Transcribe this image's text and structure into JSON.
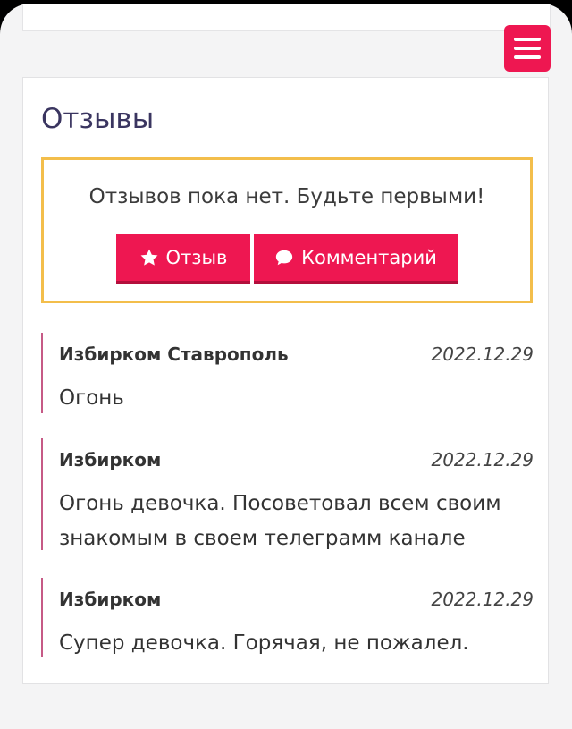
{
  "reviews": {
    "title": "Отзывы",
    "empty_message": "Отзывов пока нет. Будьте первыми!",
    "review_button_label": "Отзыв",
    "comment_button_label": "Комментарий"
  },
  "comments": [
    {
      "author": "Избирком Ставрополь",
      "date": "2022.12.29",
      "text": "Огонь"
    },
    {
      "author": "Избирком",
      "date": "2022.12.29",
      "text": "Огонь девочка. Посоветовал всем своим знакомым в своем телеграмм канале"
    },
    {
      "author": "Избирком",
      "date": "2022.12.29",
      "text": "Супер девочка. Горячая, не пожалел."
    }
  ],
  "colors": {
    "accent": "#ee1751",
    "box_border": "#f3be4b",
    "comment_rule": "#c65a86",
    "title": "#3a3560"
  },
  "icons": {
    "menu": "hamburger-menu-icon",
    "review": "star-icon",
    "comment": "speech-bubble-icon"
  }
}
